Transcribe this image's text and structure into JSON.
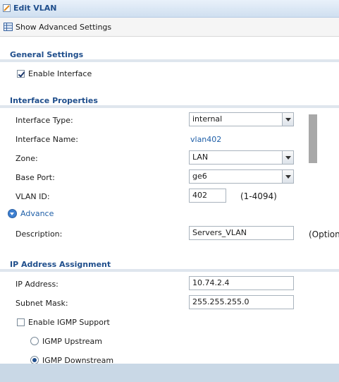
{
  "window": {
    "title": "Edit VLAN"
  },
  "toolbar": {
    "show_advanced_label": "Show Advanced Settings"
  },
  "general": {
    "title": "General Settings",
    "enable_interface_label": "Enable Interface",
    "enable_interface_checked": true
  },
  "interface": {
    "title": "Interface Properties",
    "type_label": "Interface Type:",
    "type_value": "internal",
    "name_label": "Interface Name:",
    "name_value": "vlan402",
    "zone_label": "Zone:",
    "zone_value": "LAN",
    "base_port_label": "Base Port:",
    "base_port_value": "ge6",
    "vlan_id_label": "VLAN ID:",
    "vlan_id_value": "402",
    "vlan_id_range": "(1-4094)",
    "advance_label": "Advance",
    "description_label": "Description:",
    "description_value": "Servers_VLAN",
    "description_hint": "(Optiona"
  },
  "ip": {
    "title": "IP Address Assignment",
    "address_label": "IP Address:",
    "address_value": "10.74.2.4",
    "mask_label": "Subnet Mask:",
    "mask_value": "255.255.255.0",
    "igmp_label": "Enable IGMP Support",
    "igmp_checked": false,
    "upstream_label": "IGMP Upstream",
    "downstream_label": "IGMP Downstream",
    "selected_mode": "IGMP Downstream"
  },
  "colors": {
    "accent": "#1f4e8c",
    "link": "#1f5fa8",
    "footer": "#c9d8e6"
  }
}
